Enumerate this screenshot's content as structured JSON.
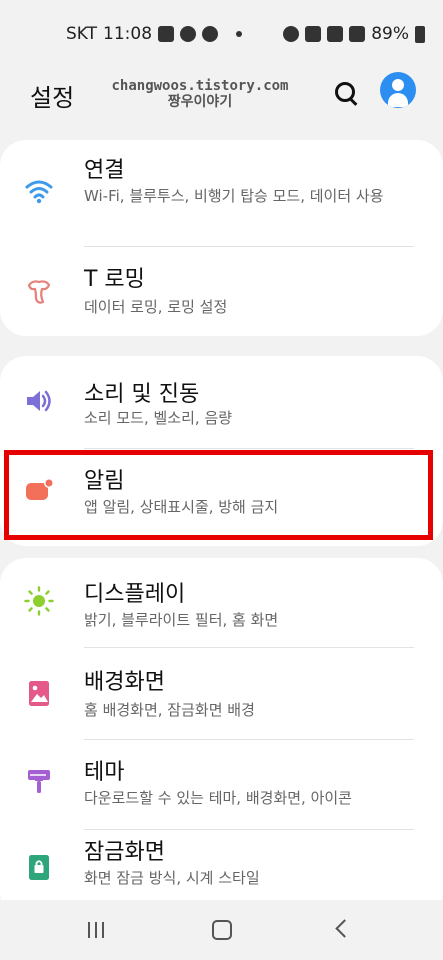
{
  "status_bar": {
    "carrier": "SKT",
    "time": "11:08",
    "battery": "89%"
  },
  "header": {
    "title": "설정",
    "watermark_line1": "changwoos.tistory.com",
    "watermark_line2": "짱우이야기"
  },
  "sections": [
    {
      "items": [
        {
          "title": "연결",
          "subtitle": "Wi-Fi, 블루투스, 비행기 탑승 모드, 데이터 사용",
          "icon": "wifi-icon",
          "icon_color": "#3d9be9"
        },
        {
          "title": "T 로밍",
          "subtitle": "데이터 로밍, 로밍 설정",
          "icon": "t-roaming-icon",
          "icon_color": "#e6807a"
        }
      ]
    },
    {
      "items": [
        {
          "title": "소리 및 진동",
          "subtitle": "소리 모드, 벨소리, 음량",
          "icon": "speaker-icon",
          "icon_color": "#7b6fd8"
        },
        {
          "title": "알림",
          "subtitle": "앱 알림, 상태표시줄, 방해 금지",
          "icon": "notification-icon",
          "icon_color": "#f2705a",
          "highlighted": true
        }
      ]
    },
    {
      "items": [
        {
          "title": "디스플레이",
          "subtitle": "밝기, 블루라이트 필터, 홈 화면",
          "icon": "sun-icon",
          "icon_color": "#8ccf2f"
        },
        {
          "title": "배경화면",
          "subtitle": "홈 배경화면, 잠금화면 배경",
          "icon": "wallpaper-icon",
          "icon_color": "#e4588a"
        },
        {
          "title": "테마",
          "subtitle": "다운로드할 수 있는 테마, 배경화면, 아이콘",
          "icon": "theme-brush-icon",
          "icon_color": "#a45fd3"
        },
        {
          "title": "잠금화면",
          "subtitle": "화면 잠금 방식, 시계 스타일",
          "icon": "lockscreen-icon",
          "icon_color": "#2fa57c"
        }
      ]
    }
  ],
  "highlight_color": "#e60000"
}
